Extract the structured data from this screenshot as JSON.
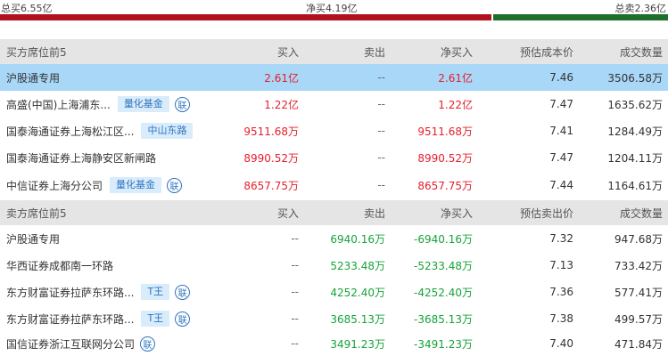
{
  "summary": {
    "buy_label": "总买6.55亿",
    "net_label": "净买4.19亿",
    "sell_label": "总卖2.36亿",
    "buy_fraction": 0.735,
    "colors": {
      "buy": "#b0131f",
      "sell": "#1f6f2b"
    }
  },
  "buy_section": {
    "headers": {
      "name": "买方席位前5",
      "buy": "买入",
      "sell": "卖出",
      "net": "净买入",
      "price": "预估成本价",
      "volume": "成交数量"
    },
    "rows": [
      {
        "name": "沪股通专用",
        "buy": "2.61亿",
        "sell": "--",
        "net": "2.61亿",
        "price": "7.46",
        "volume": "3506.58万"
      },
      {
        "name": "高盛(中国)上海浦东...",
        "tag": "量化基金",
        "lian": "联",
        "buy": "1.22亿",
        "sell": "--",
        "net": "1.22亿",
        "price": "7.47",
        "volume": "1635.62万"
      },
      {
        "name": "国泰海通证券上海松江区...",
        "tag": "中山东路",
        "buy": "9511.68万",
        "sell": "--",
        "net": "9511.68万",
        "price": "7.41",
        "volume": "1284.49万"
      },
      {
        "name": "国泰海通证券上海静安区新闸路",
        "buy": "8990.52万",
        "sell": "--",
        "net": "8990.52万",
        "price": "7.47",
        "volume": "1204.11万"
      },
      {
        "name": "中信证券上海分公司",
        "tag": "量化基金",
        "lian": "联",
        "buy": "8657.75万",
        "sell": "--",
        "net": "8657.75万",
        "price": "7.44",
        "volume": "1164.61万"
      }
    ]
  },
  "sell_section": {
    "headers": {
      "name": "卖方席位前5",
      "buy": "买入",
      "sell": "卖出",
      "net": "净买入",
      "price": "预估卖出价",
      "volume": "成交数量"
    },
    "rows": [
      {
        "name": "沪股通专用",
        "buy": "--",
        "sell": "6940.16万",
        "net": "-6940.16万",
        "price": "7.32",
        "volume": "947.68万"
      },
      {
        "name": "华西证券成都南一环路",
        "buy": "--",
        "sell": "5233.48万",
        "net": "-5233.48万",
        "price": "7.13",
        "volume": "733.42万"
      },
      {
        "name": "东方财富证券拉萨东环路...",
        "tag": "T王",
        "lian": "联",
        "buy": "--",
        "sell": "4252.40万",
        "net": "-4252.40万",
        "price": "7.36",
        "volume": "577.41万"
      },
      {
        "name": "东方财富证券拉萨东环路...",
        "tag": "T王",
        "lian": "联",
        "buy": "--",
        "sell": "3685.13万",
        "net": "-3685.13万",
        "price": "7.38",
        "volume": "499.57万"
      },
      {
        "name": "国信证券浙江互联网分公司",
        "lian": "联",
        "buy": "--",
        "sell": "3491.23万",
        "net": "-3491.23万",
        "price": "7.40",
        "volume": "471.84万"
      }
    ]
  }
}
